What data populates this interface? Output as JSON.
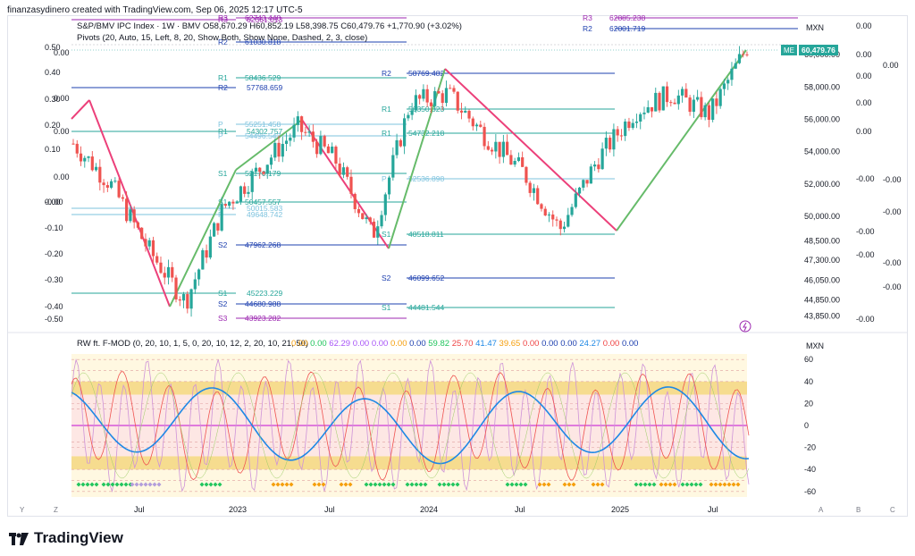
{
  "header": {
    "credit": "finanzasydinero created with TradingView.com, Sep 06, 2025 12:17 UTC-5"
  },
  "brand": {
    "name": "TradingView"
  },
  "price_panel": {
    "title_line": "S&P/BMV IPC Index · 1W · BMV  O58,670.29  H60,852.19  L58,398.75  C60,479.76  +1,770.90 (+3.02%)",
    "pivots_line": "Pivots (20, Auto, 15, Left, 8, 20, Show Both, Show None, Dashed, 2, 3, close)",
    "currency": "MXN",
    "last_tag_label": "ME",
    "last_price": "60,479.76",
    "price_axis_labels": [
      "60,000.00",
      "58,000.00",
      "56,000.00",
      "54,000.00",
      "52,000.00",
      "50,000.00",
      "48,500.00",
      "47,300.00",
      "46,050.00",
      "44,850.00",
      "43,850.00"
    ],
    "overlay_left_labels": [
      "0.50",
      "0.40",
      "0.30",
      "0.20",
      "0.10",
      "0.00",
      "-0.10",
      "-0.20",
      "-0.30",
      "-0.40",
      "-0.50",
      "-0.00",
      "0.00",
      "0.00",
      "0.00",
      "0.00"
    ],
    "overlay_right_labels": [
      "0.00",
      "0.00",
      "0.00",
      "0.00",
      "0.00",
      "0.00",
      "-0.00",
      "-0.00",
      "-0.00",
      "-0.00",
      "-0.00",
      "-0.00",
      "-0.00",
      "-0.00"
    ],
    "pivot_labels": [
      {
        "tag": "R3",
        "value": "62561.013"
      },
      {
        "tag": "R2",
        "value": "57768.659"
      },
      {
        "tag": "R1",
        "value": "54302.757"
      },
      {
        "tag": "P",
        "value": "50015.583"
      },
      {
        "tag": "P",
        "value": "49648.742"
      },
      {
        "tag": "S1",
        "value": "45223.229"
      },
      {
        "tag": "R3",
        "value": "62743.448"
      },
      {
        "tag": "R2",
        "value": "61030.818"
      },
      {
        "tag": "R1",
        "value": "58436.529"
      },
      {
        "tag": "P",
        "value": "55251.458"
      },
      {
        "tag": "P",
        "value": "54496.543"
      },
      {
        "tag": "S1",
        "value": "52170.179"
      },
      {
        "tag": "S1",
        "value": "50457.557"
      },
      {
        "tag": "S2",
        "value": "47962.268"
      },
      {
        "tag": "S2",
        "value": "44680.988"
      },
      {
        "tag": "S3",
        "value": "43923.282"
      },
      {
        "tag": "R3",
        "value": "62885.238"
      },
      {
        "tag": "R2",
        "value": "62001.719"
      },
      {
        "tag": "R2",
        "value": "58769.482"
      },
      {
        "tag": "R1",
        "value": "56350.323"
      },
      {
        "tag": "R1",
        "value": "54732.218"
      },
      {
        "tag": "P",
        "value": "52536.898"
      },
      {
        "tag": "S1",
        "value": "48518.811"
      },
      {
        "tag": "S2",
        "value": "46099.652"
      },
      {
        "tag": "S1",
        "value": "44481.544"
      }
    ]
  },
  "indicator_panel": {
    "legend_name": "RW ft. F-MOD (0, 20, 10, 1, 5, 0, 20, 10, 12, 2, 20, 10, 21, 50)",
    "legend_values": [
      {
        "v": "0.00",
        "color": "#f59e0b"
      },
      {
        "v": "0.00",
        "color": "#22c55e"
      },
      {
        "v": "62.29",
        "color": "#a855f7"
      },
      {
        "v": "0.00",
        "color": "#a855f7"
      },
      {
        "v": "0.00",
        "color": "#a855f7"
      },
      {
        "v": "0.00",
        "color": "#f59e0b"
      },
      {
        "v": "0.00",
        "color": "#1e40af"
      },
      {
        "v": "59.82",
        "color": "#22c55e"
      },
      {
        "v": "25.70",
        "color": "#ef4444"
      },
      {
        "v": "41.47",
        "color": "#1e88e5"
      },
      {
        "v": "39.65",
        "color": "#f59e0b"
      },
      {
        "v": "0.00",
        "color": "#ef4444"
      },
      {
        "v": "0.00",
        "color": "#1e40af"
      },
      {
        "v": "0.00",
        "color": "#1e40af"
      },
      {
        "v": "24.27",
        "color": "#1e88e5"
      },
      {
        "v": "0.00",
        "color": "#ef4444"
      },
      {
        "v": "0.00",
        "color": "#1e40af"
      }
    ],
    "currency": "MXN",
    "axis_labels": [
      "60",
      "40",
      "20",
      "0",
      "-20",
      "-40",
      "-60"
    ]
  },
  "time_axis": {
    "labels": [
      "Jul",
      "2023",
      "Jul",
      "2024",
      "Jul",
      "2025",
      "Jul"
    ]
  },
  "bottom_buttons": {
    "left": [
      "Y",
      "Z"
    ],
    "right": [
      "A",
      "B",
      "C"
    ]
  },
  "chart_data": {
    "type": "candlestick",
    "title": "S&P/BMV IPC Index · 1W · BMV",
    "ohlc_last": {
      "open": 58670.29,
      "high": 60852.19,
      "low": 58398.75,
      "close": 60479.76,
      "change": 1770.9,
      "change_pct": 3.02
    },
    "y_axis": {
      "min": 43850,
      "max": 60000,
      "unit": "MXN"
    },
    "x_ticks": [
      "Jul",
      "2023",
      "Jul",
      "2024",
      "Jul",
      "2025",
      "Jul"
    ],
    "approx_close_path": [
      {
        "t": "2022-04",
        "close": 54500
      },
      {
        "t": "2022-05",
        "close": 52000
      },
      {
        "t": "2022-06",
        "close": 48000
      },
      {
        "t": "2022-09",
        "close": 44700
      },
      {
        "t": "2022-11",
        "close": 50500
      },
      {
        "t": "2023-03",
        "close": 53000
      },
      {
        "t": "2023-04",
        "close": 55500
      },
      {
        "t": "2023-06",
        "close": 53500
      },
      {
        "t": "2023-10",
        "close": 48800
      },
      {
        "t": "2023-12",
        "close": 57000
      },
      {
        "t": "2024-02",
        "close": 57600
      },
      {
        "t": "2024-05",
        "close": 55000
      },
      {
        "t": "2024-08",
        "close": 52800
      },
      {
        "t": "2024-12",
        "close": 49200
      },
      {
        "t": "2025-03",
        "close": 53500
      },
      {
        "t": "2025-04",
        "close": 56500
      },
      {
        "t": "2025-05",
        "close": 57600
      },
      {
        "t": "2025-07",
        "close": 56300
      },
      {
        "t": "2025-09",
        "close": 60479.76
      }
    ],
    "indicator": {
      "name": "RW ft. F-MOD",
      "y_range": [
        -60,
        60
      ],
      "upper_band": [
        28,
        40
      ],
      "lower_band": [
        -40,
        -28
      ]
    }
  }
}
